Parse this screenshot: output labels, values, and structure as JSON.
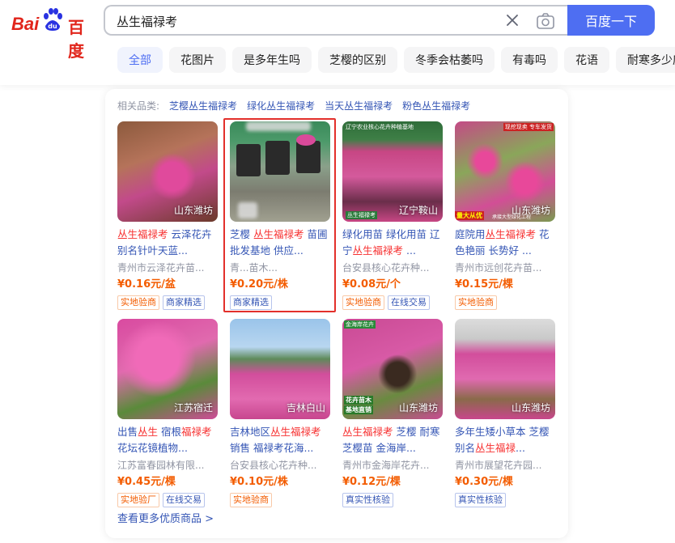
{
  "logo": {
    "bai": "Bai",
    "du": "百度"
  },
  "search": {
    "query": "丛生福禄考",
    "button_label": "百度一下"
  },
  "filters": [
    "全部",
    "花图片",
    "是多年生吗",
    "芝樱的区别",
    "冬季会枯萎吗",
    "有毒吗",
    "花语",
    "耐寒多少度"
  ],
  "related": {
    "label": "相关品类:",
    "items": [
      "芝樱丛生福禄考",
      "绿化丛生福禄考",
      "当天丛生福禄考",
      "粉色丛生福禄考"
    ]
  },
  "products": [
    {
      "location": "山东潍坊",
      "title_hl": "丛生福禄考",
      "title_rest": " 云泽花卉 别名针叶天蓝...",
      "shop": "青州市云泽花卉苗...",
      "price": "¥0.16元/盆",
      "tags": [
        "实地验商",
        "商家精选"
      ]
    },
    {
      "location": "",
      "title_pre": "芝樱 ",
      "title_hl": "丛生福禄考",
      "title_rest": " 苗圃 批发基地 供应...",
      "shop": "青...苗木...",
      "price": "¥0.20元/株",
      "tags": [
        "商家精选"
      ]
    },
    {
      "location": "辽宁鞍山",
      "title_pre": "绿化用苗 绿化用苗 辽宁",
      "title_hl": "丛生福禄考",
      "title_rest": " ...",
      "shop": "台安县核心花卉种...",
      "price": "¥0.08元/个",
      "tags": [
        "实地验商",
        "在线交易"
      ]
    },
    {
      "location": "山东潍坊",
      "title_pre": "庭院用",
      "title_hl": "丛生福禄考",
      "title_rest": " 花色艳丽 长势好 ...",
      "shop": "青州市远创花卉苗...",
      "price": "¥0.15元/棵",
      "tags": [
        "实地验商"
      ]
    },
    {
      "location": "江苏宿迁",
      "title_pre": "出售",
      "title_hl": "丛生",
      "title_rest": " 宿根",
      "title_hl2": "福禄考",
      "title_rest2": " 花坛花镜植物...",
      "shop": "江苏富春园林有限...",
      "price": "¥0.45元/棵",
      "tags": [
        "实地验厂",
        "在线交易"
      ]
    },
    {
      "location": "吉林白山",
      "title_pre": "吉林地区",
      "title_hl": "丛生福禄考",
      "title_rest": " 销售 福禄考花海...",
      "shop": "台安县核心花卉种...",
      "price": "¥0.10元/株",
      "tags": [
        "实地验商"
      ]
    },
    {
      "location": "山东潍坊",
      "title_hl": "丛生福禄考",
      "title_rest": " 芝樱 耐寒 芝樱苗 金海岸...",
      "shop": "青州市金海岸花卉...",
      "price": "¥0.12元/棵",
      "tags": [
        "真实性核验"
      ]
    },
    {
      "location": "山东潍坊",
      "title_pre": "多年生矮小草本 芝樱 别名",
      "title_hl": "丛生福禄",
      "title_rest": "...",
      "shop": "青州市展望花卉园...",
      "price": "¥0.30元/棵",
      "tags": [
        "真实性核验"
      ]
    }
  ],
  "badges": {
    "p3_top": "辽宁农业核心花卉种植基地",
    "p3_bottom": "丛生福禄考",
    "p4_top": "现挖现卖 专车发货",
    "p4_left": "量大从优",
    "p4_mid": "承接大型绿化工程",
    "p7_top": "金海岸花卉",
    "p7_left1": "花卉苗木",
    "p7_left2": "基地直销"
  },
  "more_link": "查看更多优质商品 >"
}
